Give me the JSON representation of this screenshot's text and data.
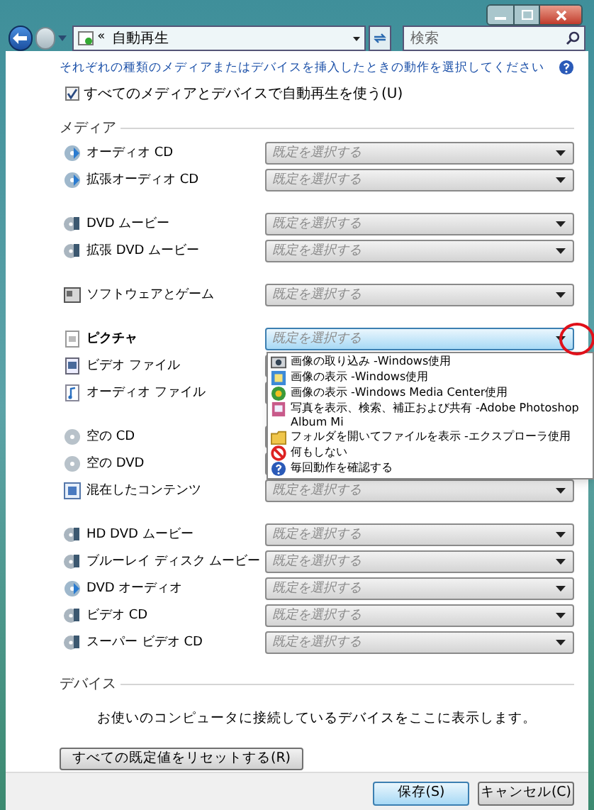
{
  "address": {
    "chevron": "«",
    "path": "自動再生"
  },
  "search": {
    "placeholder": "検索"
  },
  "instruction": "それぞれの種類のメディアまたはデバイスを挿入したときの動作を選択してください",
  "autoplay_checkbox": {
    "label": "すべてのメディアとデバイスで自動再生を使う(U)",
    "checked": true
  },
  "media_heading": "メディア",
  "media_groups": [
    [
      {
        "label": "オーディオ CD",
        "kind": "cd",
        "value": "既定を選択する",
        "open": false
      },
      {
        "label": "拡張オーディオ CD",
        "kind": "cd",
        "value": "既定を選択する",
        "open": false
      }
    ],
    [
      {
        "label": "DVD ムービー",
        "kind": "dvd",
        "value": "既定を選択する",
        "open": false
      },
      {
        "label": "拡張 DVD ムービー",
        "kind": "dvd",
        "value": "既定を選択する",
        "open": false
      }
    ],
    [
      {
        "label": "ソフトウェアとゲーム",
        "kind": "software",
        "value": "既定を選択する",
        "open": false
      }
    ],
    [
      {
        "label": "ピクチャ",
        "kind": "picture",
        "value": "既定を選択する",
        "open": true,
        "options": [
          {
            "label": "画像の取り込み -Windows使用",
            "kind": "import"
          },
          {
            "label": "画像の表示 -Windows使用",
            "kind": "viewer"
          },
          {
            "label": "画像の表示 -Windows Media Center使用",
            "kind": "media-center"
          },
          {
            "label": "写真を表示、検索、補正および共有 -Adobe Photoshop Album Mi",
            "kind": "album"
          },
          {
            "label": "フォルダを開いてファイルを表示 -エクスプローラ使用",
            "kind": "folder"
          },
          {
            "label": "何もしない",
            "kind": "none"
          },
          {
            "label": "毎回動作を確認する",
            "kind": "ask"
          }
        ]
      },
      {
        "label": "ビデオ ファイル",
        "kind": "video",
        "open": false
      },
      {
        "label": "オーディオ ファイル",
        "kind": "audio",
        "open": false
      }
    ],
    [
      {
        "label": "空の CD",
        "kind": "blank",
        "open": false
      },
      {
        "label": "空の DVD",
        "kind": "blank",
        "open": false
      },
      {
        "label": "混在したコンテンツ",
        "kind": "mixed",
        "value": "既定を選択する",
        "open": false
      }
    ],
    [
      {
        "label": "HD DVD ムービー",
        "kind": "dvd",
        "value": "既定を選択する",
        "open": false
      },
      {
        "label": "ブルーレイ ディスク ムービー",
        "kind": "dvd",
        "value": "既定を選択する",
        "open": false
      },
      {
        "label": "DVD オーディオ",
        "kind": "cd",
        "value": "既定を選択する",
        "open": false
      },
      {
        "label": "ビデオ CD",
        "kind": "dvd",
        "value": "既定を選択する",
        "open": false
      },
      {
        "label": "スーパー ビデオ CD",
        "kind": "dvd",
        "value": "既定を選択する",
        "open": false
      }
    ]
  ],
  "devices_heading": "デバイス",
  "devices_message": "お使いのコンピュータに接続しているデバイスをここに表示します。",
  "reset_button": "すべての既定値をリセットする(R)",
  "buttons": [
    {
      "label": "保存(S)",
      "kind": "primary"
    },
    {
      "label": "キャンセル(C)",
      "kind": "normal"
    }
  ]
}
